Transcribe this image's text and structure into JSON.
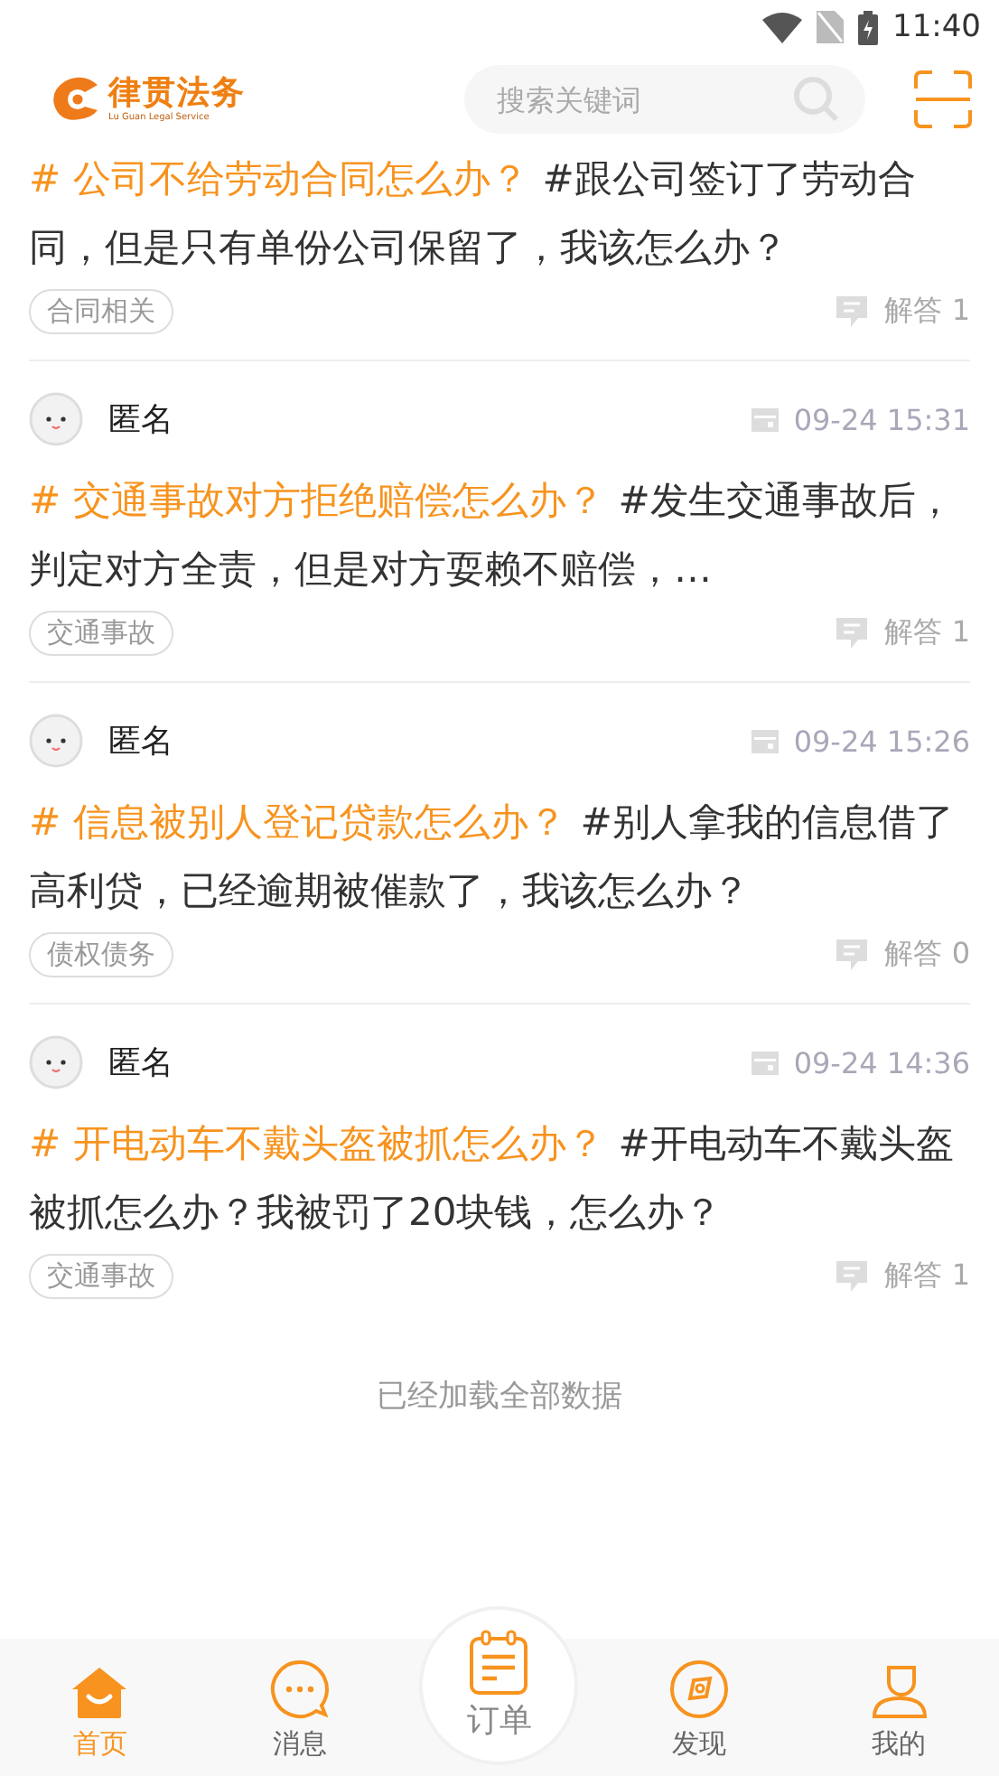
{
  "status_bar": {
    "time": "11:40"
  },
  "header": {
    "logo_title": "律贯法务",
    "logo_subtitle": "Lu Guan Legal Service",
    "search": {
      "placeholder": "搜索关键词"
    }
  },
  "posts": [
    {
      "topic": "# 公司不给劳动合同怎么办？",
      "body": "#跟公司签订了劳动合同，但是只有单份公司保留了，我该怎么办？",
      "tag": "合同相关",
      "answers": "解答 1"
    },
    {
      "author": "匿名",
      "time": "09-24 15:31",
      "topic": "# 交通事故对方拒绝赔偿怎么办？",
      "body": "#发生交通事故后，判定对方全责，但是对方耍赖不赔偿，…",
      "tag": "交通事故",
      "answers": "解答 1"
    },
    {
      "author": "匿名",
      "time": "09-24 15:26",
      "topic": "# 信息被别人登记贷款怎么办？",
      "body": "#别人拿我的信息借了高利贷，已经逾期被催款了，我该怎么办？",
      "tag": "债权债务",
      "answers": "解答 0"
    },
    {
      "author": "匿名",
      "time": "09-24 14:36",
      "topic": "# 开电动车不戴头盔被抓怎么办？",
      "body": "#开电动车不戴头盔被抓怎么办？我被罚了20块钱，怎么办？",
      "tag": "交通事故",
      "answers": "解答 1"
    }
  ],
  "footer_note": "已经加载全部数据",
  "nav": [
    {
      "kind": "home",
      "label": "首页",
      "selected": true
    },
    {
      "kind": "message",
      "label": "消息",
      "selected": false
    },
    {
      "kind": "order",
      "label": "订单",
      "selected": false
    },
    {
      "kind": "discover",
      "label": "发现",
      "selected": false
    },
    {
      "kind": "profile",
      "label": "我的",
      "selected": false
    }
  ]
}
